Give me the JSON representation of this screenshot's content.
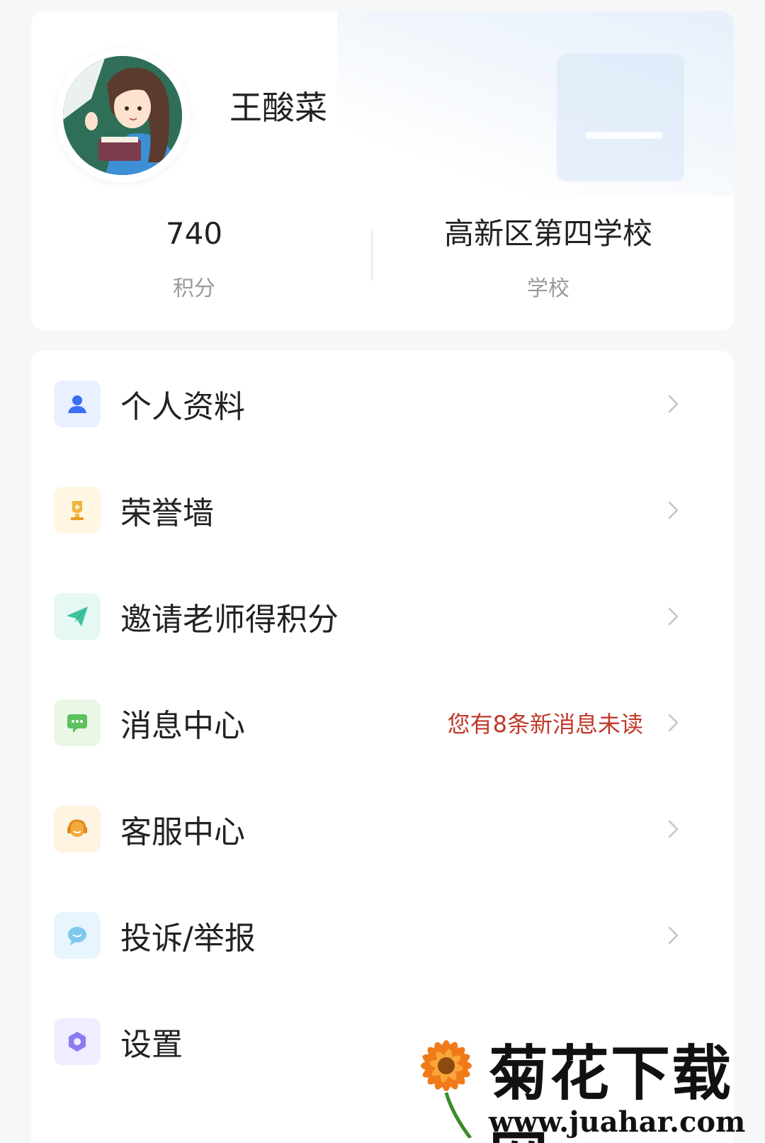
{
  "profile": {
    "name": "王酸菜",
    "points_value": "740",
    "points_label": "积分",
    "school_value": "高新区第四学校",
    "school_label": "学校"
  },
  "menu": {
    "items": [
      {
        "label": "个人资料",
        "icon": "user-icon",
        "color": "#3b6ef5",
        "bg": "#e9f0ff"
      },
      {
        "label": "荣誉墙",
        "icon": "trophy-icon",
        "color": "#f0b43a",
        "bg": "#fff6e4"
      },
      {
        "label": "邀请老师得积分",
        "icon": "paper-plane-icon",
        "color": "#3cc3a0",
        "bg": "#e6f8f3"
      },
      {
        "label": "消息中心",
        "icon": "message-icon",
        "color": "#5cc05c",
        "bg": "#eaf7e6",
        "badge": "您有8条新消息未读"
      },
      {
        "label": "客服中心",
        "icon": "headset-icon",
        "color": "#f3a93c",
        "bg": "#fff3e2"
      },
      {
        "label": "投诉/举报",
        "icon": "chat-bubble-icon",
        "color": "#7fc8ef",
        "bg": "#e8f5fc"
      },
      {
        "label": "设置",
        "icon": "gear-icon",
        "color": "#8a7cf0",
        "bg": "#efedff"
      }
    ]
  },
  "watermark": {
    "text": "菊花下载网",
    "url": "www.juahar.com"
  }
}
